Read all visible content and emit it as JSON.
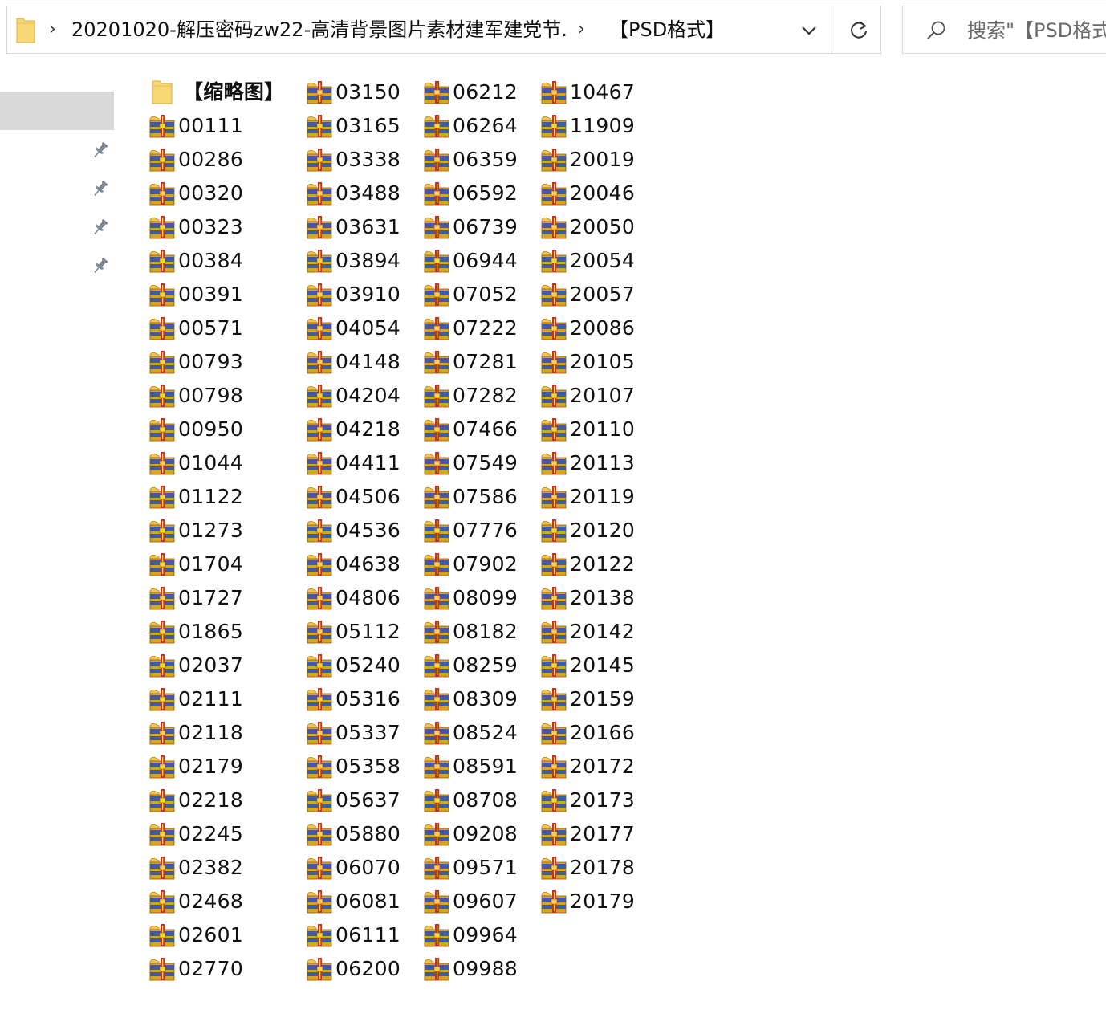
{
  "address_bar": {
    "crumbs": [
      "20201020-解压密码zw22-高清背景图片素材建军建党节...",
      "【PSD格式】"
    ],
    "separator": "›",
    "dropdown_icon": "chevron-down-icon",
    "refresh_icon": "refresh-icon"
  },
  "search": {
    "placeholder": "搜索\"【PSD格式】\"",
    "icon": "search-icon"
  },
  "nav_pane": {
    "pinned_count": 4,
    "pin_icon": "pin-icon"
  },
  "colors": {
    "folder": "#f8d775",
    "archive_band_blue": "#3e5aa8",
    "archive_band_red": "#c8322c",
    "archive_band_gold": "#d9a520",
    "selection_gray": "#d9d9d9"
  },
  "files": {
    "columns": [
      [
        "【缩略图】",
        "00111",
        "00286",
        "00320",
        "00323",
        "00384",
        "00391",
        "00571",
        "00793",
        "00798",
        "00950",
        "01044",
        "01122",
        "01273",
        "01704",
        "01727",
        "01865",
        "02037",
        "02111",
        "02118",
        "02179",
        "02218",
        "02245",
        "02382",
        "02468",
        "02601",
        "02770"
      ],
      [
        "03150",
        "03165",
        "03338",
        "03488",
        "03631",
        "03894",
        "03910",
        "04054",
        "04148",
        "04204",
        "04218",
        "04411",
        "04506",
        "04536",
        "04638",
        "04806",
        "05112",
        "05240",
        "05316",
        "05337",
        "05358",
        "05637",
        "05880",
        "06070",
        "06081",
        "06111",
        "06200"
      ],
      [
        "06212",
        "06264",
        "06359",
        "06592",
        "06739",
        "06944",
        "07052",
        "07222",
        "07281",
        "07282",
        "07466",
        "07549",
        "07586",
        "07776",
        "07902",
        "08099",
        "08182",
        "08259",
        "08309",
        "08524",
        "08591",
        "08708",
        "09208",
        "09571",
        "09607",
        "09964",
        "09988"
      ],
      [
        "10467",
        "11909",
        "20019",
        "20046",
        "20050",
        "20054",
        "20057",
        "20086",
        "20105",
        "20107",
        "20110",
        "20113",
        "20119",
        "20120",
        "20122",
        "20138",
        "20142",
        "20145",
        "20159",
        "20166",
        "20172",
        "20173",
        "20177",
        "20178",
        "20179"
      ]
    ],
    "folder_names": [
      "【缩略图】"
    ]
  }
}
